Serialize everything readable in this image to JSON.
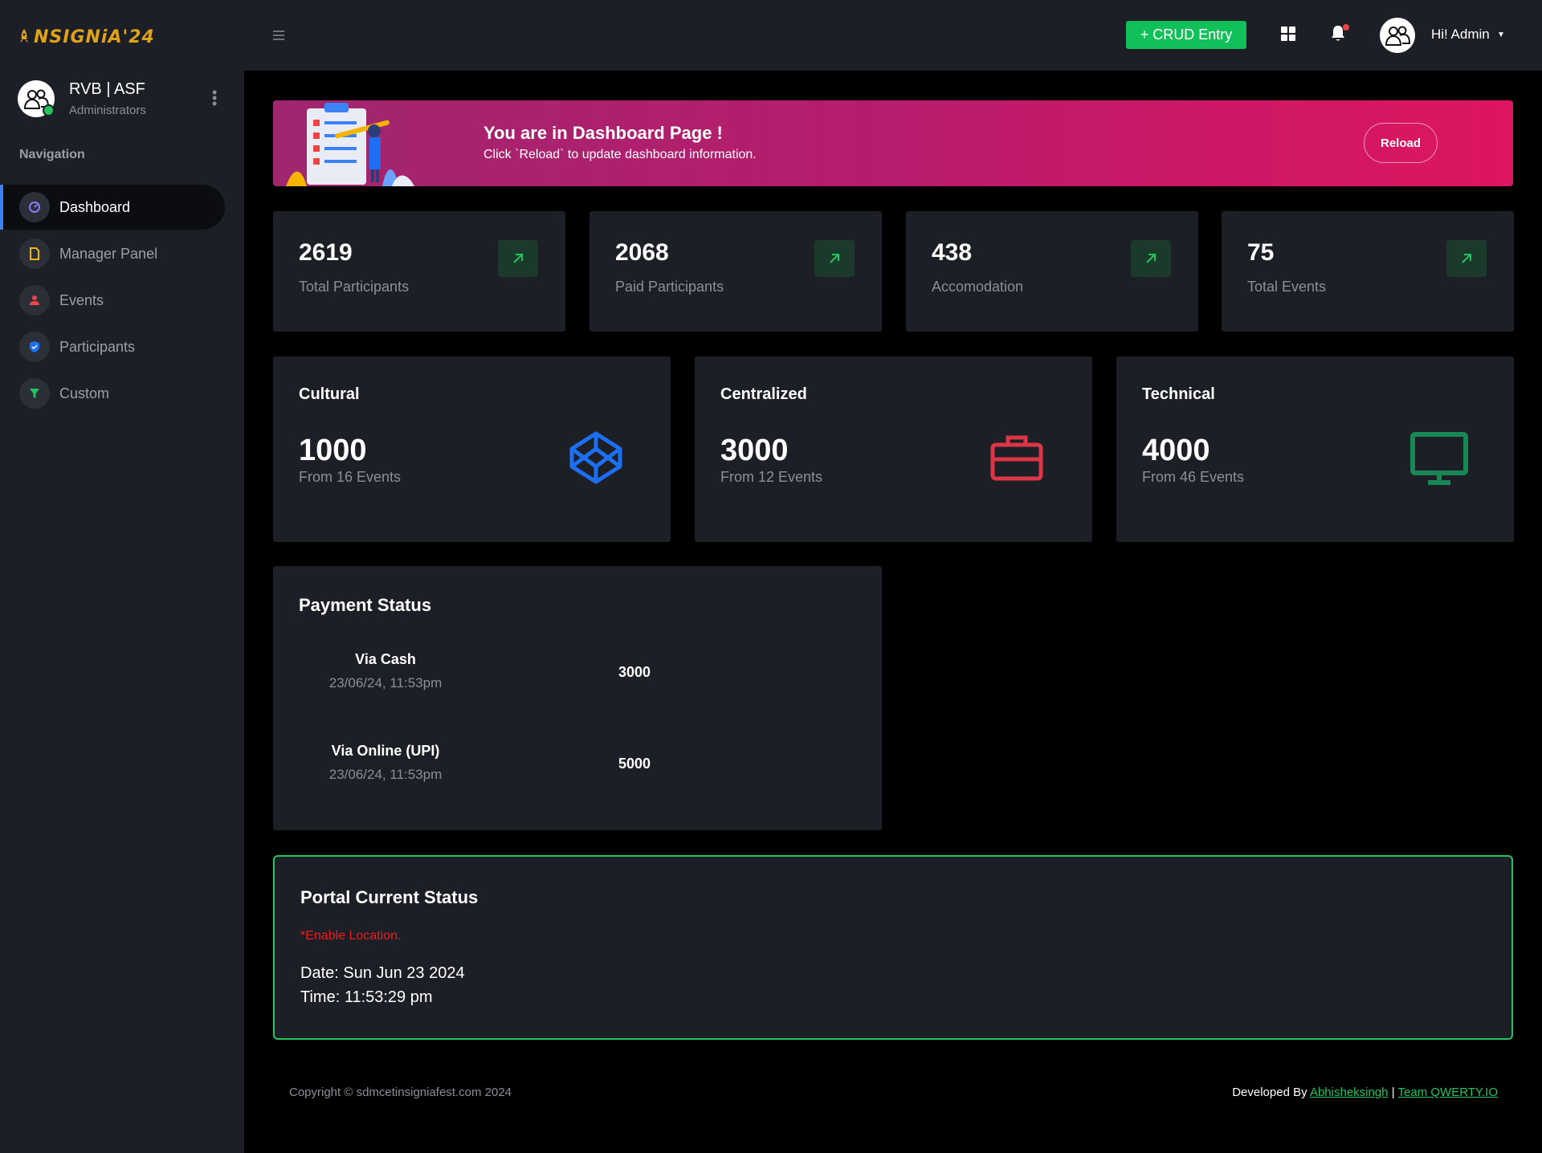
{
  "brand": {
    "logo_text": "NSIGNiA'24",
    "accent": "#e0a11b"
  },
  "profile": {
    "name": "RVB | ASF",
    "role": "Administrators"
  },
  "nav": {
    "heading": "Navigation",
    "items": [
      {
        "label": "Dashboard",
        "icon": "gauge-icon",
        "active": true
      },
      {
        "label": "Manager Panel",
        "icon": "file-icon"
      },
      {
        "label": "Events",
        "icon": "person-icon"
      },
      {
        "label": "Participants",
        "icon": "shield-icon"
      },
      {
        "label": "Custom",
        "icon": "filter-icon"
      }
    ]
  },
  "topbar": {
    "crud_label": "+ CRUD Entry",
    "greeting": "Hi! Admin"
  },
  "banner": {
    "title": "You are in Dashboard Page !",
    "subtitle": "Click `Reload` to update dashboard information.",
    "reload_label": "Reload"
  },
  "stats": [
    {
      "value": "2619",
      "label": "Total Participants"
    },
    {
      "value": "2068",
      "label": "Paid Participants"
    },
    {
      "value": "438",
      "label": "Accomodation"
    },
    {
      "value": "75",
      "label": "Total Events"
    }
  ],
  "categories": [
    {
      "title": "Cultural",
      "value": "1000",
      "sub": "From 16 Events",
      "icon": "codepen-icon",
      "color": "#1d6ff2"
    },
    {
      "title": "Centralized",
      "value": "3000",
      "sub": "From 12 Events",
      "icon": "briefcase-icon",
      "color": "#dc3545"
    },
    {
      "title": "Technical",
      "value": "4000",
      "sub": "From 46 Events",
      "icon": "monitor-icon",
      "color": "#198754"
    }
  ],
  "payment": {
    "title": "Payment Status",
    "rows": [
      {
        "method": "Via Cash",
        "date": "23/06/24, 11:53pm",
        "amount": "3000"
      },
      {
        "method": "Via Online (UPI)",
        "date": "23/06/24, 11:53pm",
        "amount": "5000"
      }
    ]
  },
  "portal": {
    "title": "Portal Current Status",
    "warning": "*Enable Location.",
    "date": "Date: Sun Jun 23 2024",
    "time": "Time: 11:53:29 pm"
  },
  "footer": {
    "copyright": "Copyright © sdmcetinsigniafest.com 2024",
    "developed_by": "Developed By",
    "author_link": "Abhisheksingh",
    "separator": "|",
    "team_link": "Team QWERTY.IO"
  }
}
